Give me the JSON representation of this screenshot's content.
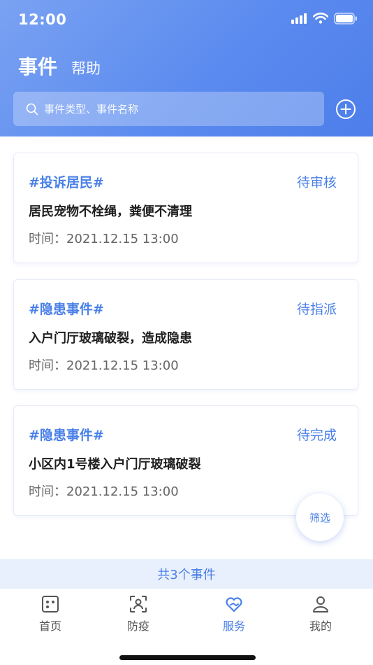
{
  "status_bar": {
    "time": "12:00"
  },
  "header": {
    "title": "事件",
    "help": "帮助",
    "search": {
      "placeholder": "事件类型、事件名称",
      "value": ""
    }
  },
  "events": [
    {
      "tag": "#投诉居民#",
      "status": "待审核",
      "title": "居民宠物不栓绳，粪便不清理",
      "time": "时间：2021.12.15 13:00"
    },
    {
      "tag": "#隐患事件#",
      "status": "待指派",
      "title": "入户门厅玻璃破裂，造成隐患",
      "time": "时间：2021.12.15 13:00"
    },
    {
      "tag": "#隐患事件#",
      "status": "待完成",
      "title": "小区内1号楼入户门厅玻璃破裂",
      "time": "时间：2021.12.15 13:00"
    }
  ],
  "filter_button": "筛选",
  "total": "共3个事件",
  "tabbar": {
    "items": [
      {
        "label": "首页",
        "icon": "home-icon",
        "active": false
      },
      {
        "label": "防疫",
        "icon": "scan-face-icon",
        "active": false
      },
      {
        "label": "服务",
        "icon": "heart-service-icon",
        "active": true
      },
      {
        "label": "我的",
        "icon": "user-icon",
        "active": false
      }
    ]
  },
  "colors": {
    "accent": "#4a80e8",
    "header_gradient_start": "#7aa2f2",
    "header_gradient_end": "#4d7eea",
    "total_bar_bg": "#e9f0fd"
  }
}
